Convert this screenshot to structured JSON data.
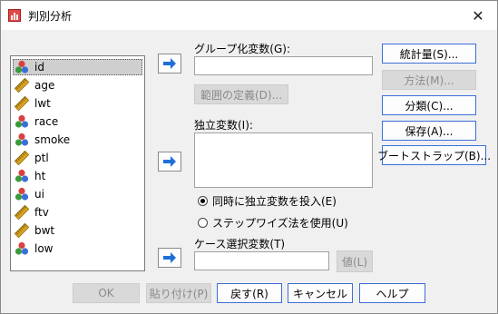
{
  "window": {
    "title": "判別分析",
    "close_glyph": "✕"
  },
  "variables": [
    {
      "name": "id",
      "type": "nominal",
      "selected": true
    },
    {
      "name": "age",
      "type": "scale"
    },
    {
      "name": "lwt",
      "type": "scale"
    },
    {
      "name": "race",
      "type": "nominal"
    },
    {
      "name": "smoke",
      "type": "nominal"
    },
    {
      "name": "ptl",
      "type": "scale"
    },
    {
      "name": "ht",
      "type": "nominal"
    },
    {
      "name": "ui",
      "type": "nominal"
    },
    {
      "name": "ftv",
      "type": "scale"
    },
    {
      "name": "bwt",
      "type": "scale"
    },
    {
      "name": "low",
      "type": "nominal"
    }
  ],
  "grouping": {
    "label": "グループ化変数(G):",
    "value": "",
    "define_range": "範囲の定義(D)..."
  },
  "independents": {
    "label": "独立変数(I):",
    "value": ""
  },
  "method": {
    "option_enter": "同時に独立変数を投入(E)",
    "option_stepwise": "ステップワイズ法を使用(U)",
    "selected": "enter"
  },
  "selection": {
    "label": "ケース選択変数(T)",
    "value": "",
    "value_button": "値(L)"
  },
  "side_buttons": {
    "statistics": "統計量(S)...",
    "method": "方法(M)...",
    "classify": "分類(C)...",
    "save": "保存(A)...",
    "bootstrap": "ブートストラップ(B)..."
  },
  "bottom_buttons": {
    "ok": "OK",
    "paste": "貼り付け(P)",
    "reset": "戻す(R)",
    "cancel": "キャンセル",
    "help": "ヘルプ"
  },
  "colors": {
    "accent": "#3b6fd8",
    "arrow": "#1e6fd9",
    "nominal_icon": [
      "#d94040",
      "#3b9a3b",
      "#3b6fd8"
    ],
    "scale_icon": "#d9a21e"
  }
}
